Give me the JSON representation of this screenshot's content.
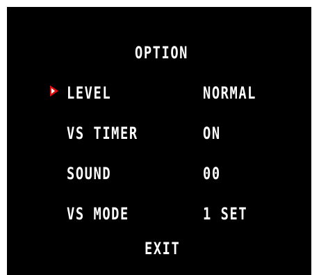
{
  "menu": {
    "title": "OPTION",
    "items": [
      {
        "label": "LEVEL",
        "value": "NORMAL",
        "selected": true
      },
      {
        "label": "VS TIMER",
        "value": "ON",
        "selected": false
      },
      {
        "label": "SOUND",
        "value": "00",
        "selected": false
      },
      {
        "label": "VS MODE",
        "value": "1 SET",
        "selected": false
      }
    ],
    "exit_label": "EXIT"
  },
  "colors": {
    "background": "#000000",
    "text": "#ffffff",
    "cursor": "#e01010",
    "page_border": "#ffffff"
  },
  "icons": {
    "cursor": "selection-arrow-icon"
  }
}
